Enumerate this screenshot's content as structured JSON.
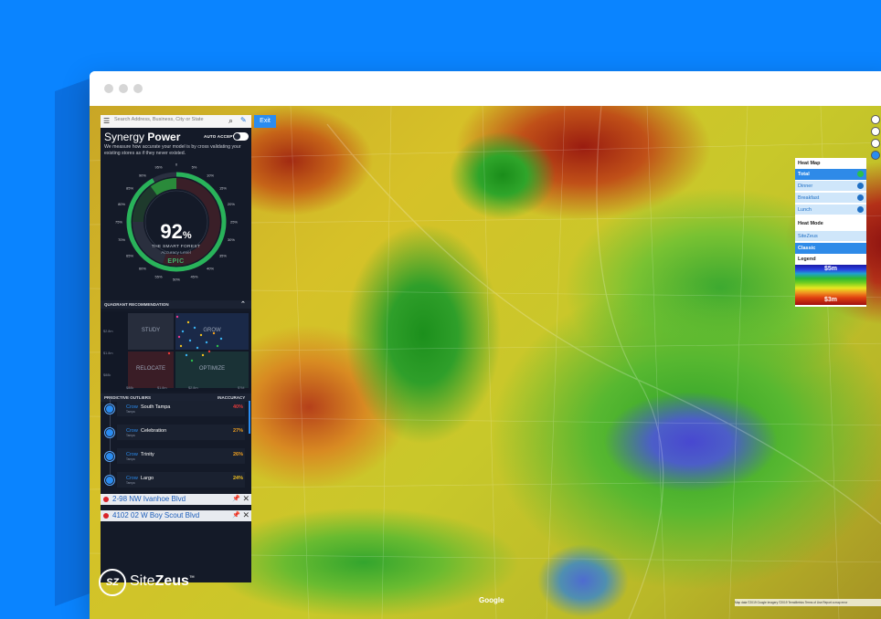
{
  "search": {
    "placeholder": "Search Address, Business, City or State"
  },
  "exit_label": "Exit",
  "synergy": {
    "title_light": "Synergy ",
    "title_bold": "Power",
    "auto_accept": "AUTO ACCEPT",
    "description": "We measure how accurate your model is by cross validating your existing stores as if they never existed."
  },
  "gauge": {
    "percent": "92",
    "percent_sign": "%",
    "subtitle": "THE SMART FOREST",
    "accuracy_label": "Accuracy Level",
    "rating": "EPIC",
    "ticks": [
      "0",
      "5%",
      "10%",
      "15%",
      "20%",
      "25%",
      "30%",
      "35%",
      "40%",
      "45%",
      "50%",
      "55%",
      "60%",
      "65%",
      "70%",
      "75%",
      "80%",
      "85%",
      "90%",
      "95%"
    ],
    "value_fraction": 0.92
  },
  "quadrant": {
    "header": "QUADRANT RECOMMENDATION",
    "study": "STUDY",
    "grow": "GROW",
    "relocate": "RELOCATE",
    "optimize": "OPTIMIZE",
    "y_labels": [
      "$2.8m",
      "$1.8m",
      "$88k"
    ],
    "x_labels": [
      "$88k",
      "$1.8m",
      "$2.8m",
      "$?M"
    ]
  },
  "outliers": {
    "header": "PREDICTIVE OUTLIERS",
    "accuracy_header": "INACCURACY",
    "rows": [
      {
        "brand": "Crow",
        "name": "South Tampa",
        "sub": "Tampa",
        "pct": "40%",
        "color": "#e23a3a"
      },
      {
        "brand": "Crow",
        "name": "Celebration",
        "sub": "Tampa",
        "pct": "27%",
        "color": "#f0a020"
      },
      {
        "brand": "Crow",
        "name": "Trinity",
        "sub": "Tampa",
        "pct": "26%",
        "color": "#f0a020"
      },
      {
        "brand": "Crow",
        "name": "Largo",
        "sub": "Tampa",
        "pct": "24%",
        "color": "#f0c020"
      }
    ]
  },
  "addresses": [
    {
      "text": "2-98 NW Ivanhoe Blvd"
    },
    {
      "text": "4102 02 W Boy Scout Blvd"
    }
  ],
  "legend_panel": {
    "heat_map": "Heat Map",
    "items": [
      "Total",
      "Dinner",
      "Breakfast",
      "Lunch"
    ],
    "heat_mode": "Heat Mode",
    "modes": [
      "SiteZeus",
      "Classic"
    ],
    "legend": "Legend",
    "top": "$5m",
    "bottom": "$3m"
  },
  "brand": {
    "logo": "SZ",
    "name_light": "Site",
    "name_bold": "Zeus",
    "tm": "™"
  },
  "google": "Google",
  "attribution": "Map data ©2019 Google  Imagery ©2019 TerraMetrics  Terms of Use  Report a map error"
}
